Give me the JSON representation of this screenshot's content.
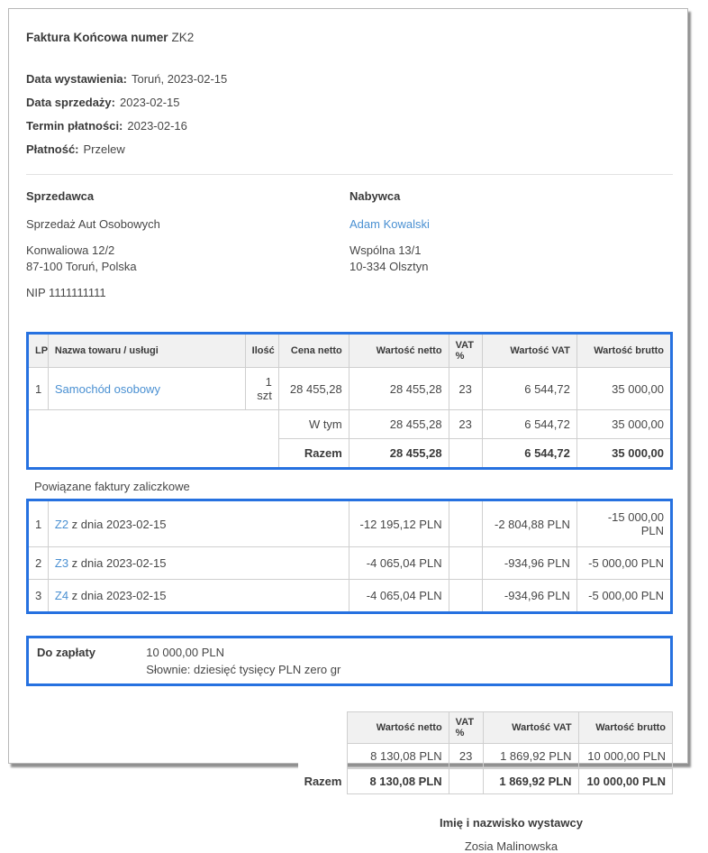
{
  "header": {
    "title_label": "Faktura Końcowa numer",
    "title_number": "ZK2"
  },
  "meta": [
    {
      "label": "Data wystawienia:",
      "value": "Toruń, 2023-02-15"
    },
    {
      "label": "Data sprzedaży:",
      "value": "2023-02-15"
    },
    {
      "label": "Termin płatności:",
      "value": "2023-02-16"
    },
    {
      "label": "Płatność:",
      "value": "Przelew"
    }
  ],
  "seller": {
    "heading": "Sprzedawca",
    "name": "Sprzedaż Aut Osobowych",
    "address_line1": "Konwaliowa 12/2",
    "address_line2": "87-100 Toruń, Polska",
    "nip": "NIP 1111111111"
  },
  "buyer": {
    "heading": "Nabywca",
    "name": "Adam Kowalski",
    "address_line1": "Wspólna 13/1",
    "address_line2": "10-334 Olsztyn"
  },
  "items_table": {
    "headers": [
      "LP",
      "Nazwa towaru / usługi",
      "Ilość",
      "Cena netto",
      "Wartość netto",
      "VAT %",
      "Wartość VAT",
      "Wartość brutto"
    ],
    "row": {
      "lp": "1",
      "name": "Samochód osobowy",
      "qty": "1 szt",
      "unit_net": "28 455,28",
      "net": "28 455,28",
      "vat_rate": "23",
      "vat": "6 544,72",
      "gross": "35 000,00"
    },
    "w_tym": {
      "label": "W tym",
      "net": "28 455,28",
      "vat_rate": "23",
      "vat": "6 544,72",
      "gross": "35 000,00"
    },
    "razem": {
      "label": "Razem",
      "net": "28 455,28",
      "vat": "6 544,72",
      "gross": "35 000,00"
    }
  },
  "advance_invoices": {
    "heading": "Powiązane faktury zaliczkowe",
    "rows": [
      {
        "lp": "1",
        "link": "Z2",
        "rest": "z dnia 2023-02-15",
        "net": "-12 195,12 PLN",
        "vat": "-2 804,88 PLN",
        "gross": "-15 000,00 PLN"
      },
      {
        "lp": "2",
        "link": "Z3",
        "rest": "z dnia 2023-02-15",
        "net": "-4 065,04 PLN",
        "vat": "-934,96 PLN",
        "gross": "-5 000,00 PLN"
      },
      {
        "lp": "3",
        "link": "Z4",
        "rest": "z dnia 2023-02-15",
        "net": "-4 065,04 PLN",
        "vat": "-934,96 PLN",
        "gross": "-5 000,00 PLN"
      }
    ]
  },
  "payment_due": {
    "label": "Do zapłaty",
    "amount": "10 000,00 PLN",
    "in_words": "Słownie: dziesięć tysięcy PLN zero gr"
  },
  "summary_table": {
    "headers": [
      "Wartość netto",
      "VAT %",
      "Wartość VAT",
      "Wartość brutto"
    ],
    "row": {
      "net": "8 130,08 PLN",
      "vat_rate": "23",
      "vat": "1 869,92 PLN",
      "gross": "10 000,00 PLN"
    },
    "razem_label": "Razem",
    "total": {
      "net": "8 130,08 PLN",
      "vat": "1 869,92 PLN",
      "gross": "10 000,00 PLN"
    }
  },
  "signature": {
    "heading": "Imię i nazwisko wystawcy",
    "name": "Zosia Malinowska"
  },
  "colors": {
    "accent_border": "#2671e0",
    "link": "#4a90d2",
    "table_header_bg": "#f1f1f1"
  }
}
